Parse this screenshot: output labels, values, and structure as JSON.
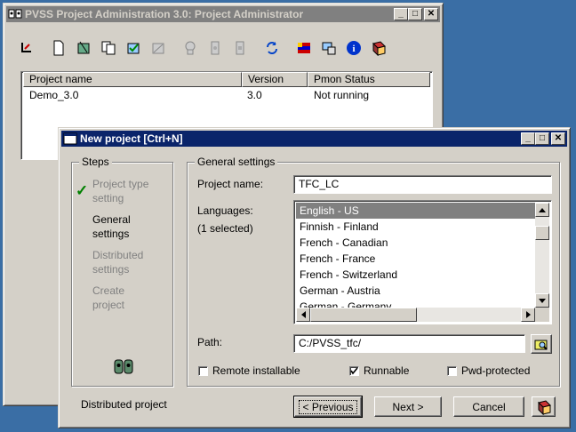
{
  "main_window": {
    "title": "PVSS Project Administration 3.0: Project Administrator",
    "list": {
      "columns": [
        "Project name",
        "Version",
        "Pmon Status"
      ],
      "rows": [
        {
          "name": "Demo_3.0",
          "version": "3.0",
          "status": "Not running"
        }
      ]
    }
  },
  "dialog": {
    "title": "New project [Ctrl+N]",
    "steps_group_label": "Steps",
    "steps": [
      {
        "label": "Project type setting",
        "state": "done"
      },
      {
        "label": "General settings",
        "state": "current"
      },
      {
        "label": "Distributed settings",
        "state": "pending"
      },
      {
        "label": "Create project",
        "state": "pending"
      }
    ],
    "settings_group_label": "General settings",
    "project_name_label": "Project name:",
    "project_name_value": "TFC_LC",
    "languages_label": "Languages:",
    "languages_selected_count": "(1 selected)",
    "languages": [
      "English - US",
      "Finnish - Finland",
      "French - Canadian",
      "French - France",
      "French - Switzerland",
      "German - Austria",
      "German - Germany"
    ],
    "selected_language": "English - US",
    "path_label": "Path:",
    "path_value": "C:/PVSS_tfc/",
    "options": [
      {
        "label": "Remote installable",
        "checked": false
      },
      {
        "label": "Runnable",
        "checked": true
      },
      {
        "label": "Pwd-protected",
        "checked": false
      }
    ],
    "distributed_note": "Distributed project",
    "buttons": {
      "previous": "< Previous",
      "next": "Next >",
      "cancel": "Cancel"
    }
  },
  "colors": {
    "desktop": "#3a6ea5",
    "active_title": "#0a246a",
    "inactive_title": "#808080",
    "face": "#d4d0c8",
    "checkmark": "#008000"
  }
}
